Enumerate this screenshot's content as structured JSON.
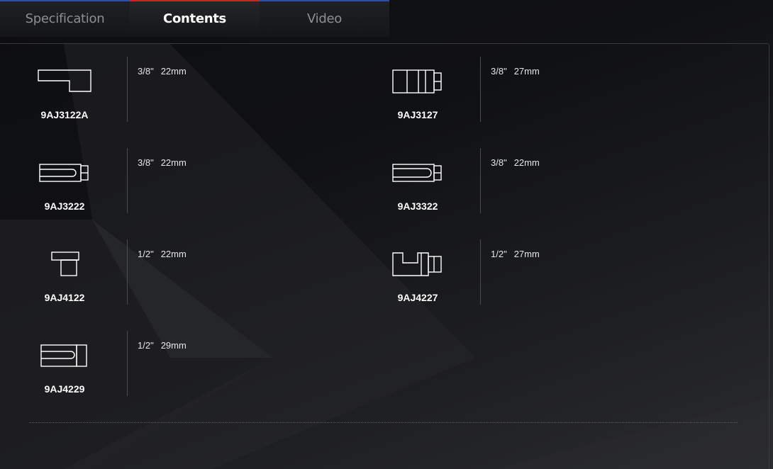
{
  "tabs": [
    {
      "label": "Specification",
      "active": false,
      "accent": "#2f4f9f"
    },
    {
      "label": "Contents",
      "active": true,
      "accent": "#c4262b"
    },
    {
      "label": "Video",
      "active": false,
      "accent": "#2f4f9f"
    }
  ],
  "items": [
    {
      "code": "9AJ3122A",
      "drive": "3/8\"",
      "size": "22mm",
      "icon": "offset-bent-socket-icon"
    },
    {
      "code": "9AJ3127",
      "drive": "3/8\"",
      "size": "27mm",
      "icon": "segmented-socket-icon"
    },
    {
      "code": "9AJ3222",
      "drive": "3/8\"",
      "size": "22mm",
      "icon": "slotted-socket-icon"
    },
    {
      "code": "9AJ3322",
      "drive": "3/8\"",
      "size": "22mm",
      "icon": "slotted-long-socket-icon"
    },
    {
      "code": "9AJ4122",
      "drive": "1/2\"",
      "size": "22mm",
      "icon": "l-shaped-socket-icon"
    },
    {
      "code": "9AJ4227",
      "drive": "1/2\"",
      "size": "27mm",
      "icon": "notched-socket-icon"
    },
    {
      "code": "9AJ4229",
      "drive": "1/2\"",
      "size": "29mm",
      "icon": "slotted-square-socket-icon"
    }
  ]
}
